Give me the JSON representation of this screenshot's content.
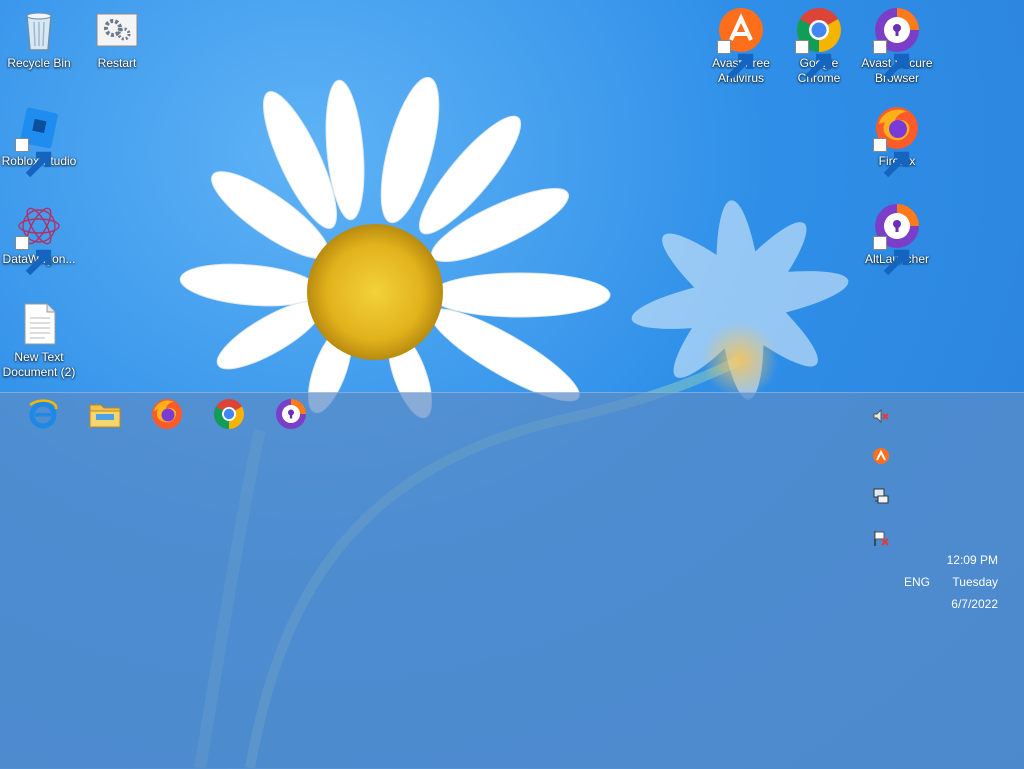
{
  "desktop": {
    "icons": [
      {
        "label": "Recycle Bin",
        "icon": "recycle-bin-icon"
      },
      {
        "label": "Restart",
        "icon": "restart-gear-icon"
      },
      {
        "label": "Roblox Studio",
        "icon": "roblox-studio-icon"
      },
      {
        "label": "DataWagon...",
        "icon": "datawagon-icon"
      },
      {
        "label": "New Text Document (2)",
        "icon": "text-document-icon"
      },
      {
        "label": "Avast Free Antivirus",
        "icon": "avast-icon"
      },
      {
        "label": "Google Chrome",
        "icon": "chrome-icon"
      },
      {
        "label": "Avast Secure Browser",
        "icon": "avast-secure-browser-icon"
      },
      {
        "label": "Firefox",
        "icon": "firefox-icon"
      },
      {
        "label": "AltLauncher",
        "icon": "altlauncher-icon"
      }
    ]
  },
  "taskbar": {
    "pinned": [
      {
        "name": "Internet Explorer",
        "icon": "internet-explorer-icon"
      },
      {
        "name": "File Explorer",
        "icon": "file-explorer-icon"
      },
      {
        "name": "Firefox",
        "icon": "firefox-icon"
      },
      {
        "name": "Google Chrome",
        "icon": "chrome-icon"
      },
      {
        "name": "Avast Secure Browser",
        "icon": "avast-secure-browser-icon"
      }
    ],
    "tray": {
      "icons": [
        "volume-muted-icon",
        "avast-tray-icon",
        "network-icon",
        "action-center-flag-icon"
      ],
      "language": "ENG",
      "time": "12:09 PM",
      "day": "Tuesday",
      "date": "6/7/2022"
    }
  }
}
